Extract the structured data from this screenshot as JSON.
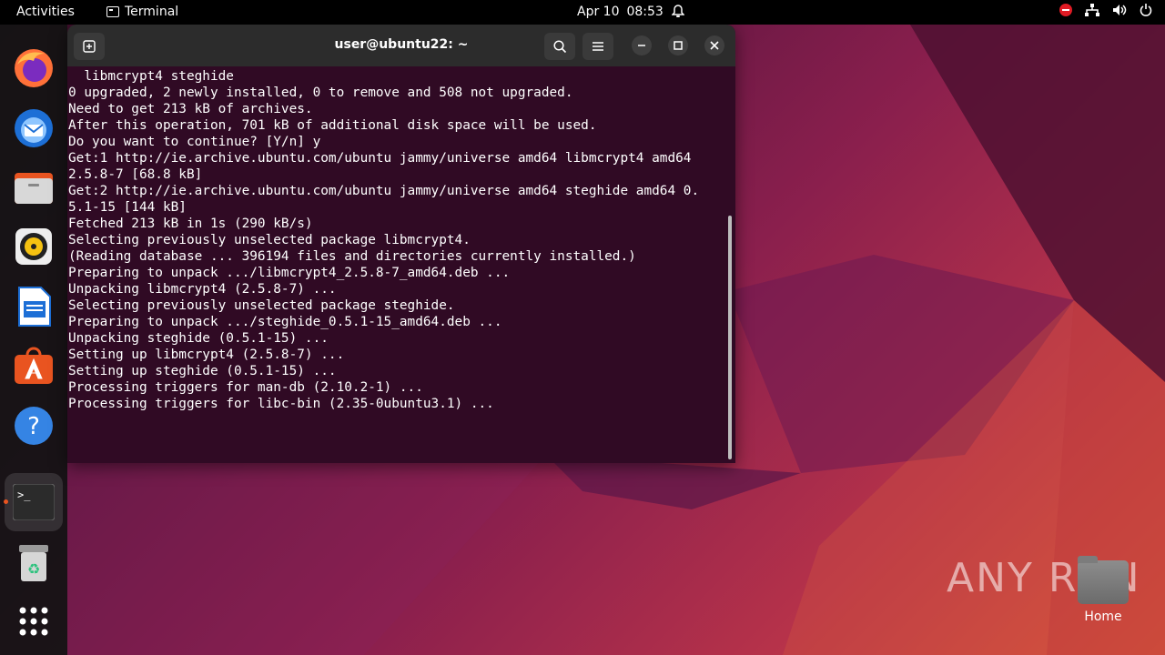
{
  "topbar": {
    "activities": "Activities",
    "app_name": "Terminal",
    "date": "Apr 10",
    "time": "08:53"
  },
  "dock": {
    "items": [
      "Firefox",
      "Thunderbird",
      "Files",
      "Rhythmbox",
      "LibreOffice Writer",
      "Ubuntu Software",
      "Help",
      "Terminal",
      "Trash",
      "Show Applications"
    ]
  },
  "window": {
    "title": "user@ubuntu22: ~",
    "lines": [
      "  libmcrypt4 steghide",
      "0 upgraded, 2 newly installed, 0 to remove and 508 not upgraded.",
      "Need to get 213 kB of archives.",
      "After this operation, 701 kB of additional disk space will be used.",
      "Do you want to continue? [Y/n] y",
      "Get:1 http://ie.archive.ubuntu.com/ubuntu jammy/universe amd64 libmcrypt4 amd64",
      "2.5.8-7 [68.8 kB]",
      "Get:2 http://ie.archive.ubuntu.com/ubuntu jammy/universe amd64 steghide amd64 0.",
      "5.1-15 [144 kB]",
      "Fetched 213 kB in 1s (290 kB/s)",
      "Selecting previously unselected package libmcrypt4.",
      "(Reading database ... 396194 files and directories currently installed.)",
      "Preparing to unpack .../libmcrypt4_2.5.8-7_amd64.deb ...",
      "Unpacking libmcrypt4 (2.5.8-7) ...",
      "Selecting previously unselected package steghide.",
      "Preparing to unpack .../steghide_0.5.1-15_amd64.deb ...",
      "Unpacking steghide (0.5.1-15) ...",
      "Setting up libmcrypt4 (2.5.8-7) ...",
      "Setting up steghide (0.5.1-15) ...",
      "Processing triggers for man-db (2.10.2-1) ...",
      "Processing triggers for libc-bin (2.35-0ubuntu3.1) ..."
    ]
  },
  "desktop": {
    "home_label": "Home",
    "watermark": "ANY RUN"
  },
  "colors": {
    "terminal_bg": "#300a24",
    "accent": "#e95420"
  }
}
